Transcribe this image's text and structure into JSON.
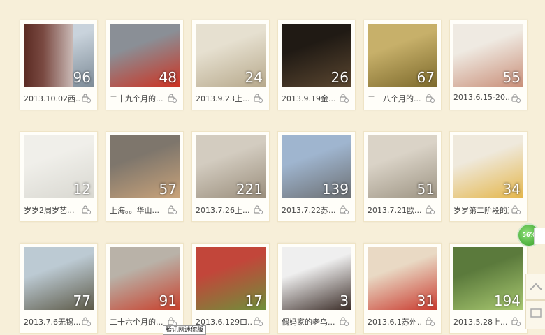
{
  "albums": [
    {
      "title": "2013.10.02西...",
      "count": "96",
      "colors": [
        "#c9d3dc",
        "#7e8c98"
      ],
      "blurred": true
    },
    {
      "title": "二十九个月的...",
      "count": "48",
      "colors": [
        "#8a8f96",
        "#cc3322"
      ]
    },
    {
      "title": "2013.9.23上...",
      "count": "24",
      "colors": [
        "#e6e0d0",
        "#b7a98c"
      ]
    },
    {
      "title": "2013.9.19金...",
      "count": "26",
      "colors": [
        "#201a14",
        "#5a4630"
      ]
    },
    {
      "title": "二十八个月的...",
      "count": "67",
      "colors": [
        "#c7b06a",
        "#7d6a2c"
      ]
    },
    {
      "title": "2013.6.15-20...",
      "count": "55",
      "colors": [
        "#efeae2",
        "#c98f79"
      ]
    },
    {
      "title": "岁岁2周岁艺...",
      "count": "12",
      "colors": [
        "#f0efea",
        "#d8d7d0"
      ]
    },
    {
      "title": "上海。。华山...",
      "count": "57",
      "colors": [
        "#7e766c",
        "#c9a37a"
      ]
    },
    {
      "title": "2013.7.26上...",
      "count": "221",
      "colors": [
        "#d3ccc0",
        "#9a8e7c"
      ]
    },
    {
      "title": "2013.7.22苏...",
      "count": "139",
      "colors": [
        "#9fb5cf",
        "#6c6f72"
      ]
    },
    {
      "title": "2013.7.21欧...",
      "count": "51",
      "colors": [
        "#dad3c7",
        "#9d9483"
      ]
    },
    {
      "title": "岁岁第二阶段的五...",
      "count": "34",
      "colors": [
        "#efe9dc",
        "#e4b64a"
      ]
    },
    {
      "title": "2013.7.6无锡...",
      "count": "77",
      "colors": [
        "#bccad3",
        "#5d5a48"
      ]
    },
    {
      "title": "二十六个月的...",
      "count": "91",
      "colors": [
        "#b9b2a8",
        "#c8412d"
      ]
    },
    {
      "title": "2013.6.129口...",
      "count": "17",
      "colors": [
        "#c2463a",
        "#6f8f3a"
      ]
    },
    {
      "title": "偶妈家的老乌...",
      "count": "3",
      "colors": [
        "#efefef",
        "#3d2f2a"
      ]
    },
    {
      "title": "2013.6.1苏州...",
      "count": "31",
      "colors": [
        "#e9d9c4",
        "#c93a2e"
      ]
    },
    {
      "title": "2013.5.28上...",
      "count": "194",
      "colors": [
        "#5b7a3c",
        "#a8c870"
      ]
    }
  ],
  "floater": {
    "percent": "56%"
  },
  "tooltip": "腾讯网迷你版"
}
